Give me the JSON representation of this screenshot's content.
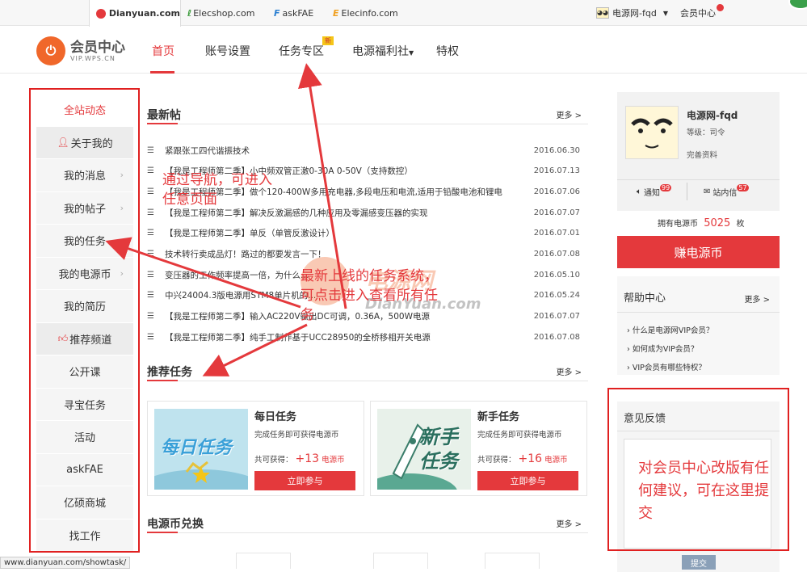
{
  "topbar": {
    "sites": [
      {
        "label": "Dianyuan.com",
        "color": "#e4393c"
      },
      {
        "label": "Elecshop.com",
        "color": "#3a9a3a"
      },
      {
        "label": "askFAE",
        "color": "#2b7fd1"
      },
      {
        "label": "Elecinfo.com",
        "color": "#f0a020"
      }
    ],
    "user": "电源网-fqd",
    "member_center": "会员中心"
  },
  "header": {
    "brand_title": "会员中心",
    "brand_sub": "VIP.WPS.CN",
    "nav": [
      "首页",
      "账号设置",
      "任务专区",
      "电源福利社",
      "特权"
    ],
    "new_badge": "新"
  },
  "sidebar": {
    "items": [
      {
        "label": "全站动态",
        "type": "active"
      },
      {
        "label": "关于我的",
        "type": "group",
        "icon": "person-icon"
      },
      {
        "label": "我的消息",
        "type": "item",
        "chevron": true
      },
      {
        "label": "我的帖子",
        "type": "item",
        "chevron": true
      },
      {
        "label": "我的任务",
        "type": "item"
      },
      {
        "label": "我的电源币",
        "type": "item",
        "chevron": true
      },
      {
        "label": "我的简历",
        "type": "item"
      },
      {
        "label": "推荐频道",
        "type": "group",
        "icon": "thumb-up-icon"
      },
      {
        "label": "公开课",
        "type": "item"
      },
      {
        "label": "寻宝任务",
        "type": "item"
      },
      {
        "label": "活动",
        "type": "item"
      },
      {
        "label": "askFAE",
        "type": "item"
      },
      {
        "label": "亿硕商城",
        "type": "item"
      },
      {
        "label": "找工作",
        "type": "item"
      }
    ]
  },
  "latest": {
    "title": "最新帖",
    "more": "更多 >",
    "posts": [
      {
        "title": "紧跟张工四代谐振技术",
        "date": "2016.06.30"
      },
      {
        "title": "【我是工程师第二季】小中频双管正激0-30A 0-50V（支持数控）",
        "date": "2016.07.13"
      },
      {
        "title": "【我是工程师第二季】做个120-400W多用充电器,多段电压和电流,适用于铅酸电池和锂电",
        "date": "2016.07.06"
      },
      {
        "title": "【我是工程师第二季】解决反激漏感的几种应用及零漏感变压器的实现",
        "date": "2016.07.07"
      },
      {
        "title": "【我是工程师第二季】单反（单管反激设计）",
        "date": "2016.07.01"
      },
      {
        "title": "技术转行卖成品灯！路过的都要发言一下！",
        "date": "2016.07.08"
      },
      {
        "title": "变压器的工作频率提高一倍，为什么...",
        "date": "2016.05.10"
      },
      {
        "title": "中兴24004.3版电源用STM8单片机的...",
        "date": "2016.05.24"
      },
      {
        "title": "【我是工程师第二季】输入AC220V输出DC可调，0.36A，500W电源",
        "date": "2016.07.07"
      },
      {
        "title": "【我是工程师第二季】纯手工制作基于UCC28950的全桥移相开关电源",
        "date": "2016.07.08"
      }
    ]
  },
  "recommend": {
    "title": "推荐任务",
    "more": "更多 >",
    "tasks": [
      {
        "name": "每日任务",
        "banner": "每日任务",
        "desc": "完成任务即可获得电源币",
        "gain_label": "共可获得：",
        "gain": "+13",
        "unit": "电源币",
        "button": "立即参与"
      },
      {
        "name": "新手任务",
        "banner": "新手任务",
        "desc": "完成任务即可获得电源币",
        "gain_label": "共可获得：",
        "gain": "+16",
        "unit": "电源币",
        "button": "立即参与"
      }
    ]
  },
  "exchange": {
    "title": "电源币兑换",
    "more": "更多 >"
  },
  "profile": {
    "username": "电源网-fqd",
    "level": "等级：司令",
    "complete": "完善资料",
    "notify": "通知",
    "notify_count": "99",
    "inbox": "站内信",
    "inbox_count": "57",
    "coins_prefix": "拥有电源币",
    "coins": "5025",
    "coins_suffix": "枚",
    "earn_button": "赚电源币"
  },
  "help": {
    "title": "帮助中心",
    "more": "更多 >",
    "items": [
      "什么是电源网VIP会员？",
      "如何成为VIP会员？",
      "VIP会员有哪些特权？"
    ]
  },
  "feedback": {
    "title": "意见反馈",
    "submit": "提交"
  },
  "annotations": {
    "nav": "通过导航，可进入任意页面",
    "task": "最新上线的任务系统，可点击进入查看所有任务",
    "feedback": "对会员中心改版有任何建议，可在这里提交"
  },
  "watermark": {
    "cn": "电源网",
    "en": "DianYuan.com"
  },
  "status_url": "www.dianyuan.com/showtask/"
}
